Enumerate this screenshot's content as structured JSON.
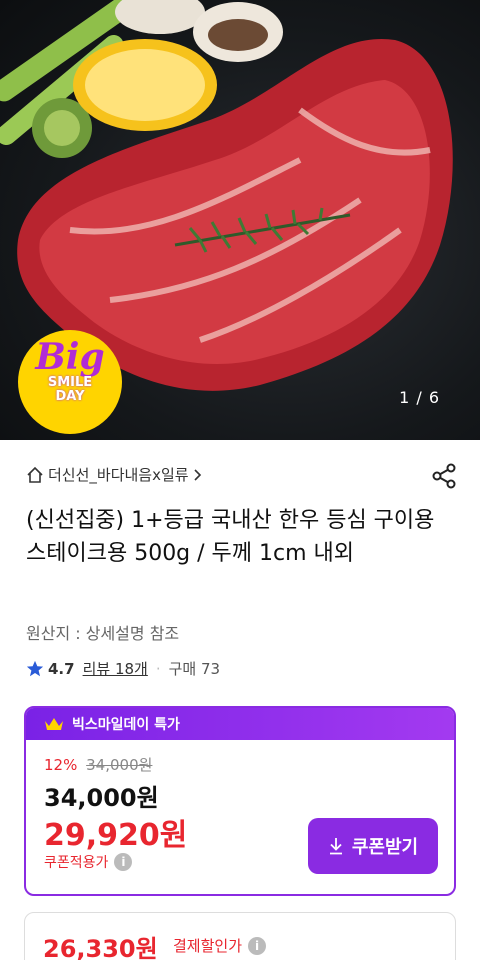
{
  "hero": {
    "image_alt": "Marbled Korean beef steak with rosemary, lemon, mushrooms and asparagus",
    "counter": "1 / 6",
    "badge_big": "Big",
    "badge_line1": "SMILE",
    "badge_line2": "DAY"
  },
  "product": {
    "store": "더신선_바다내음x일류",
    "title": "(신선집중) 1+등급 국내산 한우 등심 구이용 스테이크용 500g / 두께 1cm 내외",
    "origin": "원산지 : 상세설명 참조",
    "rating": "4.7",
    "reviews": "리뷰 18개",
    "purchases": "구매 73"
  },
  "deal": {
    "header": "빅스마일데이 특가",
    "discount_rate": "12%",
    "original_price": "34,000원",
    "price": "34,000원",
    "coupon_price": "29,920원",
    "coupon_label": "쿠폰적용가",
    "coupon_button": "쿠폰받기"
  },
  "payment": {
    "price": "26,330원",
    "label": "결제할인가"
  },
  "colors": {
    "accent_purple": "#8a2be2",
    "price_red": "#e8262f",
    "star_blue": "#2a5bd7"
  }
}
